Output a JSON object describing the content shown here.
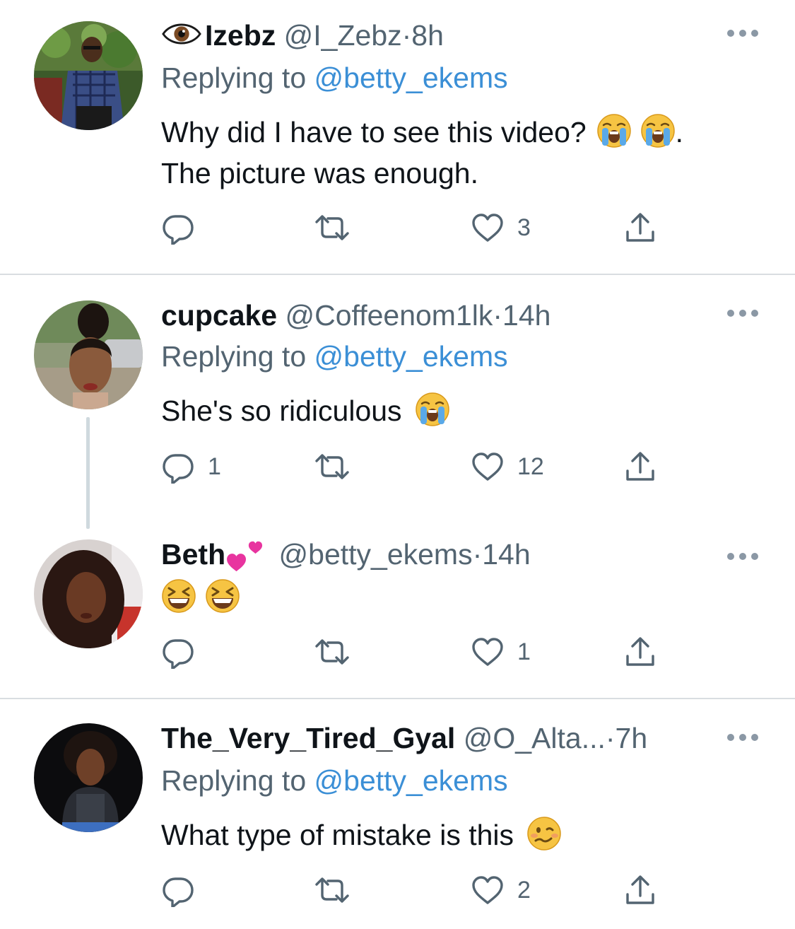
{
  "tweets": [
    {
      "name": "Izebz",
      "name_prefix_icon": "eye-emoji",
      "handle": "@I_Zebz",
      "separator": "·",
      "time": "8h",
      "replying_prefix": "Replying to",
      "replying_to": "@betty_ekems",
      "text_line1": "Why did I have to see this video?",
      "text_line1_suffix": ".",
      "text_line2": "The picture was enough.",
      "emojis": [
        "loudly-crying-face",
        "loudly-crying-face"
      ],
      "replies": "",
      "retweets": "",
      "likes": "3"
    },
    {
      "name": "cupcake",
      "handle": "@Coffeenom1lk",
      "separator": "·",
      "time": "14h",
      "replying_prefix": "Replying to",
      "replying_to": "@betty_ekems",
      "text_line1": "She's so ridiculous",
      "emojis": [
        "loudly-crying-face"
      ],
      "replies": "1",
      "retweets": "",
      "likes": "12"
    },
    {
      "name": "Beth",
      "name_suffix_icon": "two-hearts-emoji",
      "handle": "@betty_ekems",
      "separator": "·",
      "time": "14h",
      "emojis": [
        "grinning-squinting-face",
        "grinning-squinting-face"
      ],
      "replies": "",
      "retweets": "",
      "likes": "1"
    },
    {
      "name": "The_Very_Tired_Gyal",
      "handle": "@O_Alta...",
      "separator": "·",
      "time": "7h",
      "replying_prefix": "Replying to",
      "replying_to": "@betty_ekems",
      "text_line1": "What type of mistake is this",
      "emojis": [
        "woozy-face"
      ],
      "replies": "",
      "retweets": "",
      "likes": "2"
    }
  ],
  "colors": {
    "text": "#0f1419",
    "secondary": "#536471",
    "link": "#3b8fd6",
    "divider": "#d9dde1",
    "thread_line": "#cfd9de"
  }
}
